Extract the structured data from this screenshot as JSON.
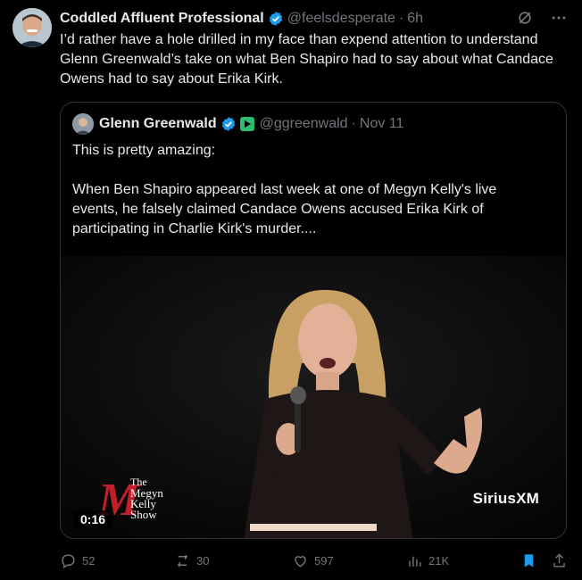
{
  "tweet": {
    "author_name": "Coddled Affluent Professional",
    "author_handle": "@feelsdesperate",
    "separator": "·",
    "time": "6h",
    "text": "I’d rather have a hole drilled in my face than expend attention to understand Glenn Greenwald’s take on what Ben Shapiro had to say about what Candace Owens had to say about Erika Kirk."
  },
  "quote": {
    "author_name": "Glenn Greenwald",
    "author_handle": "@ggreenwald",
    "separator": "·",
    "date": "Nov 11",
    "line1": "This is pretty amazing:",
    "line2": "When Ben Shapiro appeared last week at one of Megyn Kelly's live events, he falsely claimed Candace Owens accused Erika Kirk of participating in Charlie Kirk's murder....",
    "video": {
      "duration": "0:16",
      "watermark": "SiriusXM",
      "logo_lines": [
        "The",
        "Megyn",
        "Kelly",
        "Show"
      ]
    }
  },
  "actions": {
    "replies": "52",
    "reposts": "30",
    "likes": "597",
    "views": "21K"
  },
  "colors": {
    "accent": "#1d9bf0",
    "muted": "#71767b",
    "text": "#e7e9ea",
    "background": "#000000"
  }
}
